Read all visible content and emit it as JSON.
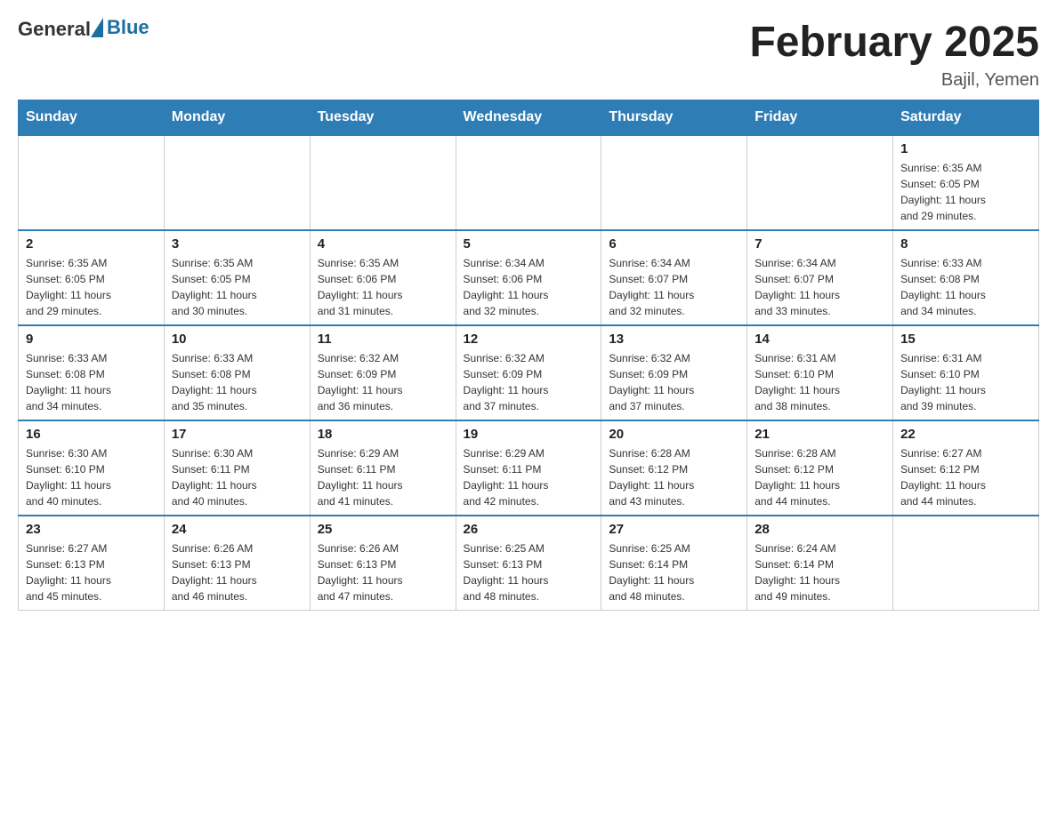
{
  "header": {
    "logo": {
      "text_general": "General",
      "text_blue": "Blue"
    },
    "title": "February 2025",
    "subtitle": "Bajil, Yemen"
  },
  "days_of_week": [
    "Sunday",
    "Monday",
    "Tuesday",
    "Wednesday",
    "Thursday",
    "Friday",
    "Saturday"
  ],
  "weeks": [
    [
      {
        "day": "",
        "info": ""
      },
      {
        "day": "",
        "info": ""
      },
      {
        "day": "",
        "info": ""
      },
      {
        "day": "",
        "info": ""
      },
      {
        "day": "",
        "info": ""
      },
      {
        "day": "",
        "info": ""
      },
      {
        "day": "1",
        "info": "Sunrise: 6:35 AM\nSunset: 6:05 PM\nDaylight: 11 hours\nand 29 minutes."
      }
    ],
    [
      {
        "day": "2",
        "info": "Sunrise: 6:35 AM\nSunset: 6:05 PM\nDaylight: 11 hours\nand 29 minutes."
      },
      {
        "day": "3",
        "info": "Sunrise: 6:35 AM\nSunset: 6:05 PM\nDaylight: 11 hours\nand 30 minutes."
      },
      {
        "day": "4",
        "info": "Sunrise: 6:35 AM\nSunset: 6:06 PM\nDaylight: 11 hours\nand 31 minutes."
      },
      {
        "day": "5",
        "info": "Sunrise: 6:34 AM\nSunset: 6:06 PM\nDaylight: 11 hours\nand 32 minutes."
      },
      {
        "day": "6",
        "info": "Sunrise: 6:34 AM\nSunset: 6:07 PM\nDaylight: 11 hours\nand 32 minutes."
      },
      {
        "day": "7",
        "info": "Sunrise: 6:34 AM\nSunset: 6:07 PM\nDaylight: 11 hours\nand 33 minutes."
      },
      {
        "day": "8",
        "info": "Sunrise: 6:33 AM\nSunset: 6:08 PM\nDaylight: 11 hours\nand 34 minutes."
      }
    ],
    [
      {
        "day": "9",
        "info": "Sunrise: 6:33 AM\nSunset: 6:08 PM\nDaylight: 11 hours\nand 34 minutes."
      },
      {
        "day": "10",
        "info": "Sunrise: 6:33 AM\nSunset: 6:08 PM\nDaylight: 11 hours\nand 35 minutes."
      },
      {
        "day": "11",
        "info": "Sunrise: 6:32 AM\nSunset: 6:09 PM\nDaylight: 11 hours\nand 36 minutes."
      },
      {
        "day": "12",
        "info": "Sunrise: 6:32 AM\nSunset: 6:09 PM\nDaylight: 11 hours\nand 37 minutes."
      },
      {
        "day": "13",
        "info": "Sunrise: 6:32 AM\nSunset: 6:09 PM\nDaylight: 11 hours\nand 37 minutes."
      },
      {
        "day": "14",
        "info": "Sunrise: 6:31 AM\nSunset: 6:10 PM\nDaylight: 11 hours\nand 38 minutes."
      },
      {
        "day": "15",
        "info": "Sunrise: 6:31 AM\nSunset: 6:10 PM\nDaylight: 11 hours\nand 39 minutes."
      }
    ],
    [
      {
        "day": "16",
        "info": "Sunrise: 6:30 AM\nSunset: 6:10 PM\nDaylight: 11 hours\nand 40 minutes."
      },
      {
        "day": "17",
        "info": "Sunrise: 6:30 AM\nSunset: 6:11 PM\nDaylight: 11 hours\nand 40 minutes."
      },
      {
        "day": "18",
        "info": "Sunrise: 6:29 AM\nSunset: 6:11 PM\nDaylight: 11 hours\nand 41 minutes."
      },
      {
        "day": "19",
        "info": "Sunrise: 6:29 AM\nSunset: 6:11 PM\nDaylight: 11 hours\nand 42 minutes."
      },
      {
        "day": "20",
        "info": "Sunrise: 6:28 AM\nSunset: 6:12 PM\nDaylight: 11 hours\nand 43 minutes."
      },
      {
        "day": "21",
        "info": "Sunrise: 6:28 AM\nSunset: 6:12 PM\nDaylight: 11 hours\nand 44 minutes."
      },
      {
        "day": "22",
        "info": "Sunrise: 6:27 AM\nSunset: 6:12 PM\nDaylight: 11 hours\nand 44 minutes."
      }
    ],
    [
      {
        "day": "23",
        "info": "Sunrise: 6:27 AM\nSunset: 6:13 PM\nDaylight: 11 hours\nand 45 minutes."
      },
      {
        "day": "24",
        "info": "Sunrise: 6:26 AM\nSunset: 6:13 PM\nDaylight: 11 hours\nand 46 minutes."
      },
      {
        "day": "25",
        "info": "Sunrise: 6:26 AM\nSunset: 6:13 PM\nDaylight: 11 hours\nand 47 minutes."
      },
      {
        "day": "26",
        "info": "Sunrise: 6:25 AM\nSunset: 6:13 PM\nDaylight: 11 hours\nand 48 minutes."
      },
      {
        "day": "27",
        "info": "Sunrise: 6:25 AM\nSunset: 6:14 PM\nDaylight: 11 hours\nand 48 minutes."
      },
      {
        "day": "28",
        "info": "Sunrise: 6:24 AM\nSunset: 6:14 PM\nDaylight: 11 hours\nand 49 minutes."
      },
      {
        "day": "",
        "info": ""
      }
    ]
  ]
}
